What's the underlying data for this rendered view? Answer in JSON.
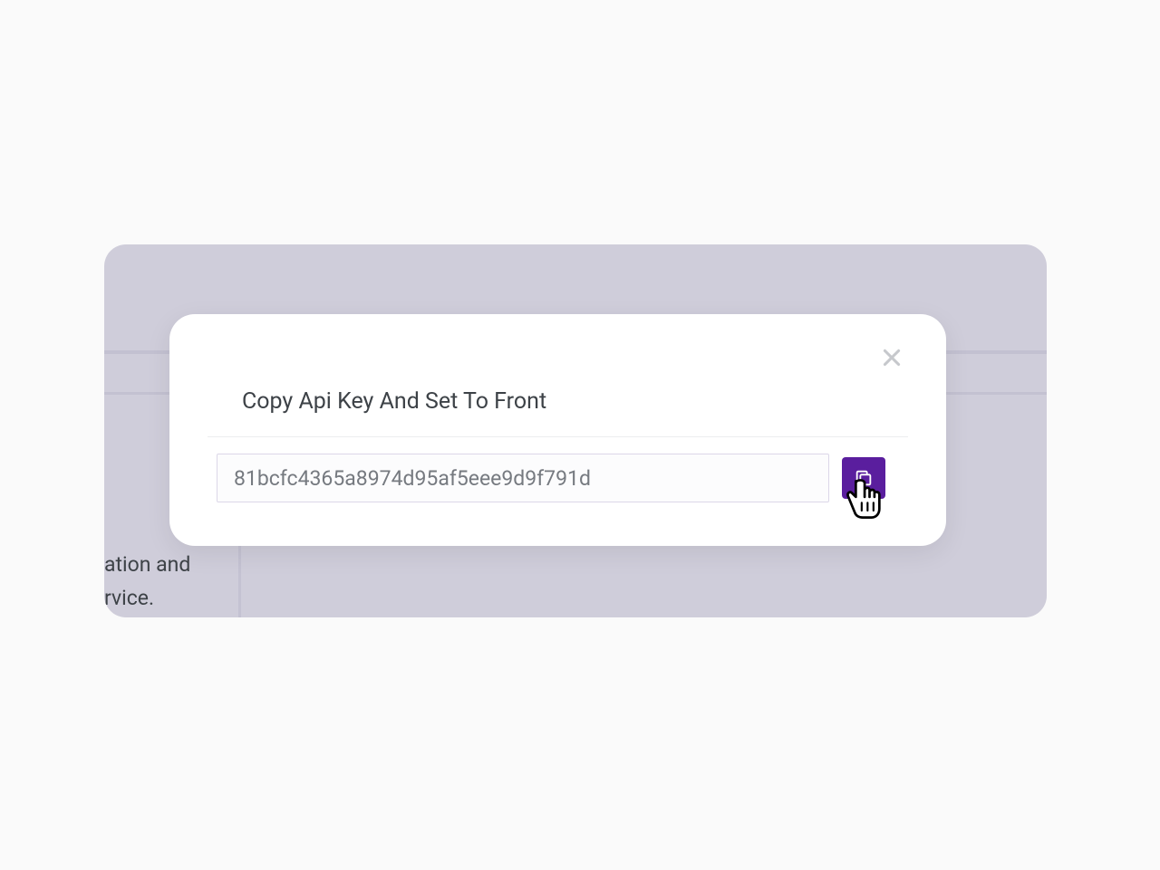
{
  "modal": {
    "title": "Copy Api Key And Set To Front",
    "api_key_value": "81bcfc4365a8974d95af5eee9d9f791d"
  },
  "backdrop": {
    "partial_text": "ation and\nrvice."
  },
  "colors": {
    "accent": "#5a1e9e",
    "backdrop": "#cfcdda"
  }
}
